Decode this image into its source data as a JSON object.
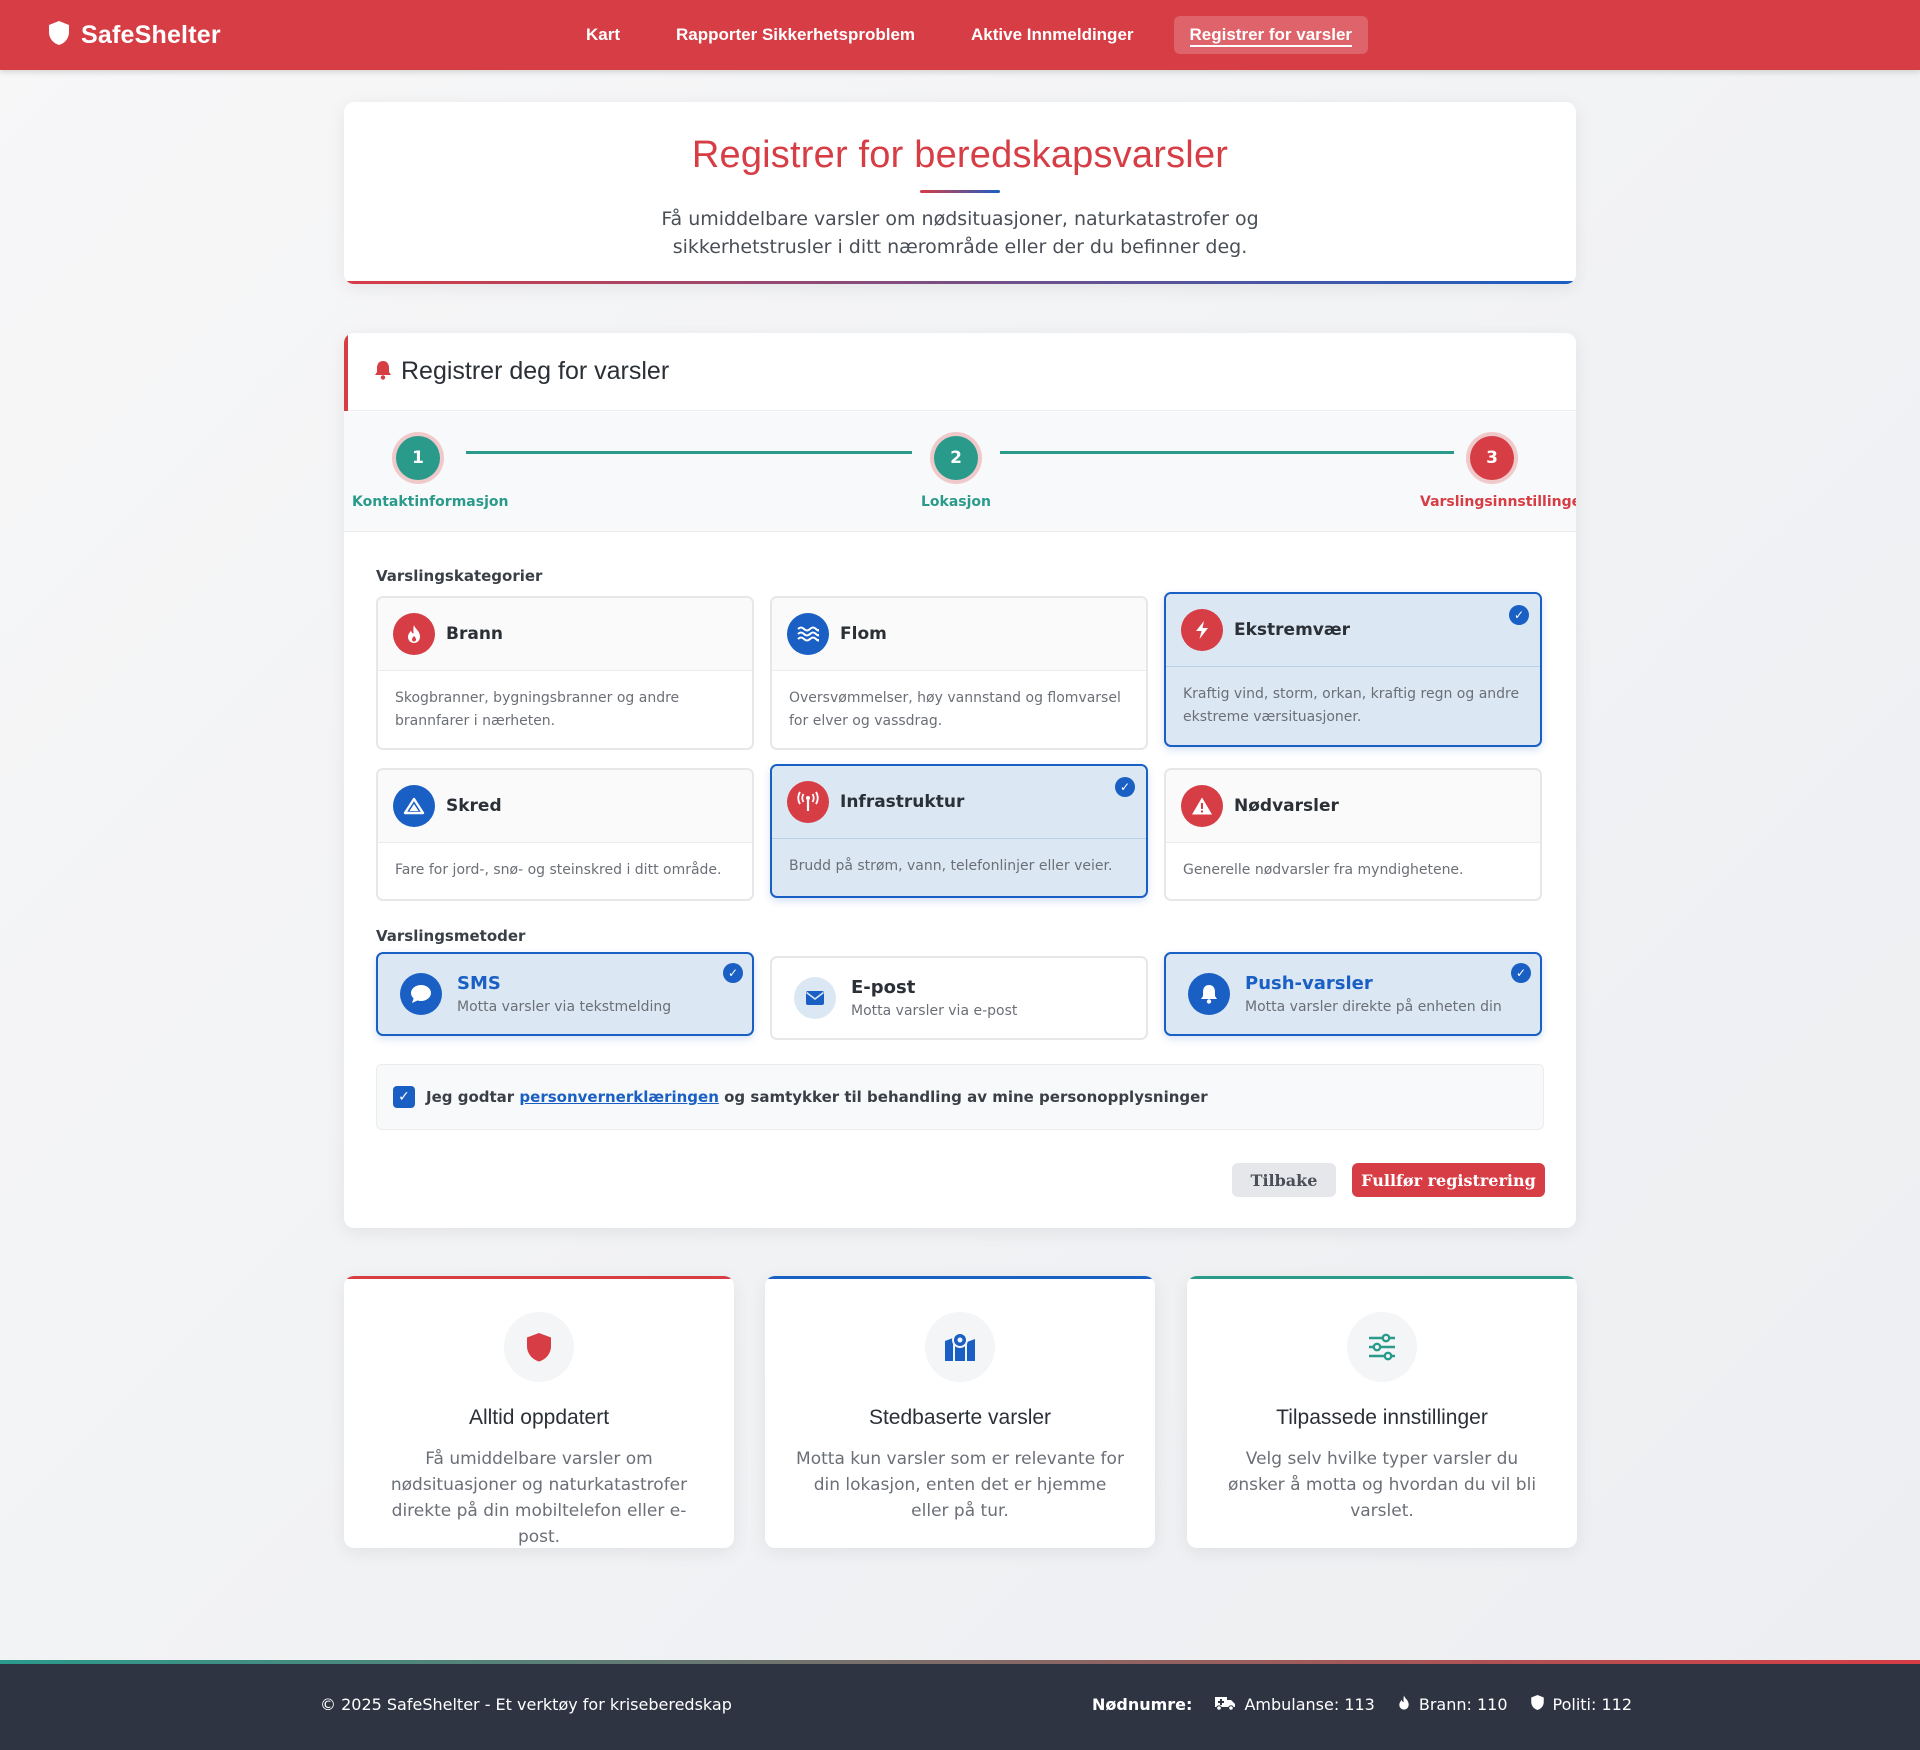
{
  "brand": {
    "name": "SafeShelter"
  },
  "nav": {
    "items": [
      {
        "label": "Kart"
      },
      {
        "label": "Rapporter Sikkerhetsproblem"
      },
      {
        "label": "Aktive Innmeldinger"
      },
      {
        "label": "Registrer for varsler",
        "active": true
      }
    ]
  },
  "hero": {
    "title": "Registrer for beredskapsvarsler",
    "subtitle": "Få umiddelbare varsler om nødsituasjoner, naturkatastrofer og sikkerhetstrusler i ditt nærområde eller der du befinner deg."
  },
  "registration": {
    "title": "Registrer deg for varsler",
    "steps": [
      {
        "number": "1",
        "label": "Kontaktinformasjon",
        "state": "done"
      },
      {
        "number": "2",
        "label": "Lokasjon",
        "state": "done"
      },
      {
        "number": "3",
        "label": "Varslingsinnstillinger",
        "state": "current"
      }
    ],
    "categories_label": "Varslingskategorier",
    "categories": [
      {
        "title": "Brann",
        "desc": "Skogbranner, bygningsbranner og andre brannfarer i nærheten.",
        "icon": "fire-icon",
        "selected": false
      },
      {
        "title": "Flom",
        "desc": "Oversvømmelser, høy vannstand og flomvarsel for elver og vassdrag.",
        "icon": "water-icon",
        "selected": false
      },
      {
        "title": "Ekstremvær",
        "desc": "Kraftig vind, storm, orkan, kraftig regn og andre ekstreme værsituasjoner.",
        "icon": "lightning-icon",
        "selected": true
      },
      {
        "title": "Skred",
        "desc": "Fare for jord-, snø- og steinskred i ditt område.",
        "icon": "mountain-icon",
        "selected": false
      },
      {
        "title": "Infrastruktur",
        "desc": "Brudd på strøm, vann, telefonlinjer eller veier.",
        "icon": "tower-icon",
        "selected": true
      },
      {
        "title": "Nødvarsler",
        "desc": "Generelle nødvarsler fra myndighetene.",
        "icon": "warning-icon",
        "selected": false
      }
    ],
    "methods_label": "Varslingsmetoder",
    "methods": [
      {
        "title": "SMS",
        "desc": "Motta varsler via tekstmelding",
        "icon": "chat-icon",
        "selected": true
      },
      {
        "title": "E-post",
        "desc": "Motta varsler via e-post",
        "icon": "envelope-icon",
        "selected": false
      },
      {
        "title": "Push-varsler",
        "desc": "Motta varsler direkte på enheten din",
        "icon": "bell-icon",
        "selected": true
      }
    ],
    "consent": {
      "prefix": "Jeg godtar",
      "link": "personvernerklæringen",
      "suffix": "og samtykker til behandling av mine personopplysninger",
      "checked": true
    },
    "back_label": "Tilbake",
    "submit_label": "Fullfør registrering"
  },
  "features": [
    {
      "title": "Alltid oppdatert",
      "desc": "Få umiddelbare varsler om nødsituasjoner og naturkatastrofer direkte på din mobiltelefon eller e-post.",
      "icon": "shield-icon",
      "accent": "#d73d45"
    },
    {
      "title": "Stedbaserte varsler",
      "desc": "Motta kun varsler som er relevante for din lokasjon, enten det er hjemme eller på tur.",
      "icon": "map-icon",
      "accent": "#1a5fc4"
    },
    {
      "title": "Tilpassede innstillinger",
      "desc": "Velg selv hvilke typer varsler du ønsker å motta og hvordan du vil bli varslet.",
      "icon": "sliders-icon",
      "accent": "#2a9a8b"
    }
  ],
  "footer": {
    "copyright": "© 2025 SafeShelter - Et verktøy for kriseberedskap",
    "emergency_label": "Nødnumre:",
    "ambulance": "Ambulanse: 113",
    "fire": "Brann: 110",
    "police": "Politi: 112"
  },
  "colors": {
    "primary": "#d73d45",
    "blue": "#1a5fc4",
    "teal": "#2a9a8b",
    "footer": "#2f3442"
  }
}
